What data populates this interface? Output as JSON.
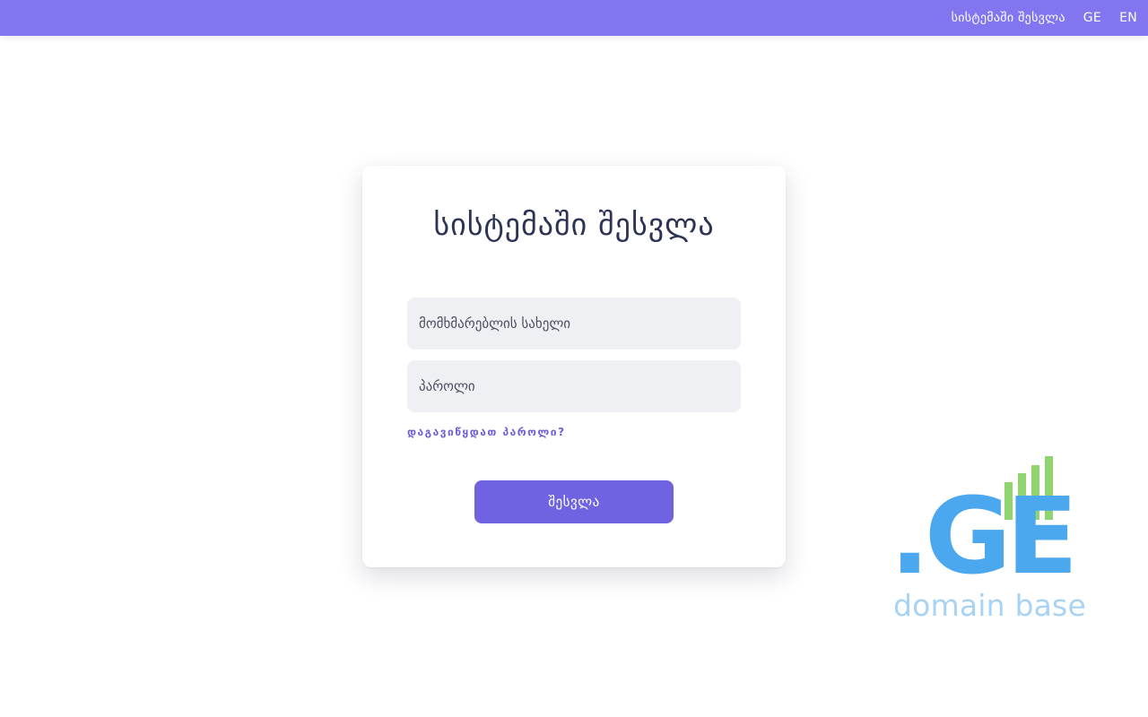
{
  "header": {
    "nav": {
      "login_label": "სისტემაში შესვლა",
      "lang_ge": "GE",
      "lang_en": "EN"
    }
  },
  "login": {
    "title": "სისტემაში შესვლა",
    "username_placeholder": "მომხმარებლის სახელი",
    "password_placeholder": "პაროლი",
    "forgot_label": "დაგავიწყდათ პაროლი?",
    "submit_label": "შესვლა"
  },
  "logo": {
    "text": ".GE",
    "caption": "domain base"
  },
  "colors": {
    "topbar": "#8176f0",
    "button": "#7063e2",
    "link": "#6c5fd8",
    "logo_blue": "#4ba8ee",
    "logo_green": "#8fd46e",
    "caption": "#a8d3f5"
  }
}
